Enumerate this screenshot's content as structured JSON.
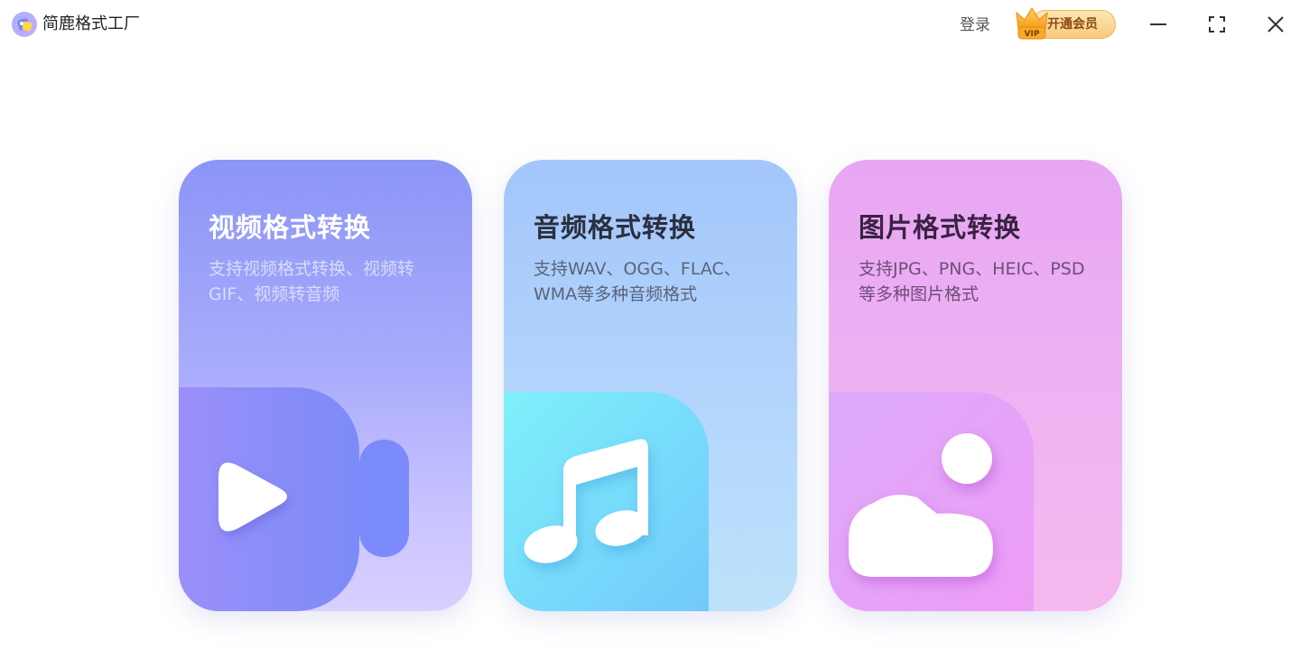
{
  "app": {
    "title": "简鹿格式工厂",
    "logo_icon": "app-logo-icon"
  },
  "header": {
    "login_label": "登录",
    "vip_label": "开通会员",
    "vip_badge_text": "VIP",
    "colors": {
      "vip_pill_top": "#fde7b6",
      "vip_pill_bottom": "#f8c97a",
      "vip_text": "#8a4b12"
    }
  },
  "window_controls": {
    "minimize_icon": "minimize-icon",
    "maximize_icon": "maximize-icon",
    "close_icon": "close-icon"
  },
  "cards": [
    {
      "id": "video",
      "title": "视频格式转换",
      "description": "支持视频格式转换、视频转GIF、视频转音频",
      "icon": "video-camera-icon",
      "color": "#8b95f6"
    },
    {
      "id": "audio",
      "title": "音频格式转换",
      "description": "支持WAV、OGG、FLAC、WMA等多种音频格式",
      "icon": "music-note-icon",
      "color": "#a3c6fb"
    },
    {
      "id": "image",
      "title": "图片格式转换",
      "description": "支持JPG、PNG、HEIC、PSD等多种图片格式",
      "icon": "image-icon",
      "color": "#e7a6f3"
    }
  ]
}
